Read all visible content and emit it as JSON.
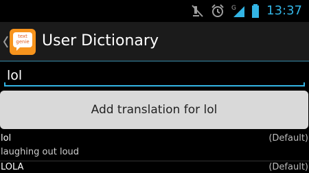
{
  "status_bar": {
    "time": "13:37",
    "icons": [
      "mute-icon",
      "alarm-icon",
      "cellular-signal-icon",
      "battery-icon"
    ],
    "network_type": "G"
  },
  "action_bar": {
    "title": "User Dictionary",
    "logo_text_line1": "text",
    "logo_text_line2": "genie"
  },
  "search": {
    "value": "lol"
  },
  "add_button": {
    "label": "Add translation for lol"
  },
  "entries": [
    {
      "word": "lol",
      "meaning": "laughing out loud",
      "tag": "(Default)"
    },
    {
      "word": "LOLA",
      "tag": "(Default)"
    }
  ],
  "colors": {
    "accent": "#33b5e5",
    "logo_orange": "#f7941d",
    "button_bg": "#d9d9d9"
  }
}
